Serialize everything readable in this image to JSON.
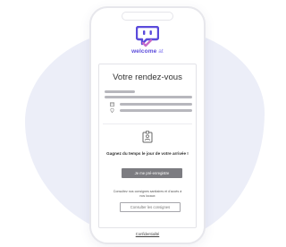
{
  "brand": {
    "word1": "welcome",
    "word2": "at",
    "logo_icon": "chat-checkmark-icon",
    "primary_color": "#5b4bdb",
    "accent_color": "#c86cc8"
  },
  "card": {
    "title": "Votre rendez-vous",
    "detail_icons": [
      "calendar-icon",
      "location-pin-icon"
    ],
    "promo_icon": "id-badge-icon",
    "promo_text": "Gagnez du temps le jour de votre arrivée !",
    "register_button": "Je me pré-enregistre",
    "consult_text": "Consultez nos consignes sanitaires et d'accès à nos locaux",
    "consult_button": "Consulter les consignes"
  },
  "footer": {
    "privacy_link": "Confidentialité"
  }
}
